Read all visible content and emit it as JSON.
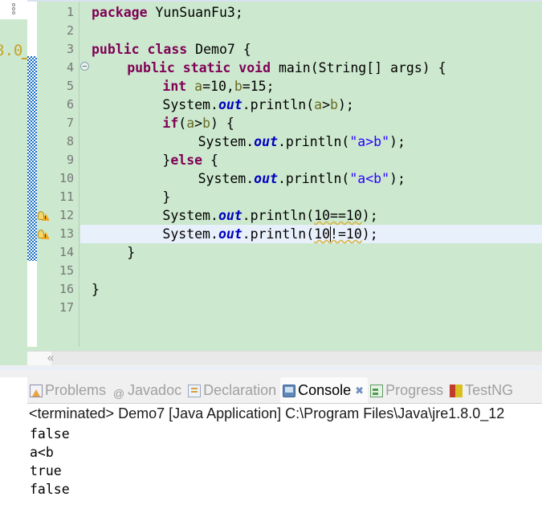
{
  "editor": {
    "background_color": "#cce8ce",
    "current_line_color": "#e8f0fb",
    "neighbor_sliver_text": "8.0",
    "drag_handle_icon": "drag-dots-icon",
    "fold_icon": "fold-collapse-icon",
    "scroll_chevron": "«",
    "line_numbers": [
      "1",
      "2",
      "3",
      "4",
      "5",
      "6",
      "7",
      "8",
      "9",
      "10",
      "11",
      "12",
      "13",
      "14",
      "15",
      "16",
      "17"
    ],
    "current_line": 13,
    "warning_lines": [
      12,
      13
    ],
    "fold_lines": [
      4
    ],
    "code_lines": [
      {
        "n": 1,
        "indent": 0,
        "tokens": [
          {
            "t": "package",
            "c": "kw"
          },
          {
            "t": " YunSuanFu3;",
            "c": ""
          }
        ]
      },
      {
        "n": 2,
        "indent": 0,
        "tokens": []
      },
      {
        "n": 3,
        "indent": 0,
        "tokens": [
          {
            "t": "public",
            "c": "kw"
          },
          {
            "t": " ",
            "c": ""
          },
          {
            "t": "class",
            "c": "kw"
          },
          {
            "t": " Demo7 {",
            "c": ""
          }
        ]
      },
      {
        "n": 4,
        "indent": 1,
        "tokens": [
          {
            "t": "public",
            "c": "kw"
          },
          {
            "t": " ",
            "c": ""
          },
          {
            "t": "static",
            "c": "kw"
          },
          {
            "t": " ",
            "c": ""
          },
          {
            "t": "void",
            "c": "kw"
          },
          {
            "t": " main(String[] args) {",
            "c": ""
          }
        ]
      },
      {
        "n": 5,
        "indent": 2,
        "tokens": [
          {
            "t": "int",
            "c": "kw"
          },
          {
            "t": " ",
            "c": ""
          },
          {
            "t": "a",
            "c": "lvar"
          },
          {
            "t": "=10,",
            "c": ""
          },
          {
            "t": "b",
            "c": "lvar"
          },
          {
            "t": "=15;",
            "c": ""
          }
        ]
      },
      {
        "n": 6,
        "indent": 2,
        "tokens": [
          {
            "t": "System.",
            "c": ""
          },
          {
            "t": "out",
            "c": "fld"
          },
          {
            "t": ".println(",
            "c": ""
          },
          {
            "t": "a",
            "c": "lvar"
          },
          {
            "t": ">",
            "c": ""
          },
          {
            "t": "b",
            "c": "lvar"
          },
          {
            "t": ");",
            "c": ""
          }
        ]
      },
      {
        "n": 7,
        "indent": 2,
        "tokens": [
          {
            "t": "if",
            "c": "kw"
          },
          {
            "t": "(",
            "c": ""
          },
          {
            "t": "a",
            "c": "lvar"
          },
          {
            "t": ">",
            "c": ""
          },
          {
            "t": "b",
            "c": "lvar"
          },
          {
            "t": ") {",
            "c": ""
          }
        ]
      },
      {
        "n": 8,
        "indent": 3,
        "tokens": [
          {
            "t": "System.",
            "c": ""
          },
          {
            "t": "out",
            "c": "fld"
          },
          {
            "t": ".println(",
            "c": ""
          },
          {
            "t": "\"a>b\"",
            "c": "str"
          },
          {
            "t": ");",
            "c": ""
          }
        ]
      },
      {
        "n": 9,
        "indent": 2,
        "tokens": [
          {
            "t": "}",
            "c": ""
          },
          {
            "t": "else",
            "c": "kw"
          },
          {
            "t": " {",
            "c": ""
          }
        ]
      },
      {
        "n": 10,
        "indent": 3,
        "tokens": [
          {
            "t": "System.",
            "c": ""
          },
          {
            "t": "out",
            "c": "fld"
          },
          {
            "t": ".println(",
            "c": ""
          },
          {
            "t": "\"a<b\"",
            "c": "str"
          },
          {
            "t": ");",
            "c": ""
          }
        ]
      },
      {
        "n": 11,
        "indent": 2,
        "tokens": [
          {
            "t": "}",
            "c": ""
          }
        ]
      },
      {
        "n": 12,
        "indent": 2,
        "tokens": [
          {
            "t": "System.",
            "c": ""
          },
          {
            "t": "out",
            "c": "fld"
          },
          {
            "t": ".println(",
            "c": ""
          },
          {
            "t": "10==10",
            "c": "warnu"
          },
          {
            "t": ");",
            "c": ""
          }
        ]
      },
      {
        "n": 13,
        "indent": 2,
        "tokens": [
          {
            "t": "System.",
            "c": ""
          },
          {
            "t": "out",
            "c": "fld"
          },
          {
            "t": ".println(",
            "c": ""
          },
          {
            "t": "10!=10",
            "c": "warnu"
          },
          {
            "t": ");",
            "c": ""
          }
        ]
      },
      {
        "n": 14,
        "indent": 1,
        "tokens": [
          {
            "t": "}",
            "c": ""
          }
        ]
      },
      {
        "n": 15,
        "indent": 0,
        "tokens": []
      },
      {
        "n": 16,
        "indent": 0,
        "tokens": [
          {
            "t": "}",
            "c": ""
          }
        ]
      },
      {
        "n": 17,
        "indent": 0,
        "tokens": []
      }
    ]
  },
  "bottom_view": {
    "tabs": [
      {
        "label": "Problems",
        "icon": "problems-icon",
        "active": false,
        "closable": false
      },
      {
        "label": "Javadoc",
        "icon": "javadoc-icon",
        "active": false,
        "closable": false
      },
      {
        "label": "Declaration",
        "icon": "declaration-icon",
        "active": false,
        "closable": false
      },
      {
        "label": "Console",
        "icon": "console-icon",
        "active": true,
        "closable": true,
        "close_glyph": "✖"
      },
      {
        "label": "Progress",
        "icon": "progress-icon",
        "active": false,
        "closable": false
      },
      {
        "label": "TestNG",
        "icon": "testng-icon",
        "active": false,
        "closable": false
      }
    ],
    "console": {
      "header": "<terminated> Demo7 [Java Application] C:\\Program Files\\Java\\jre1.8.0_12",
      "output": [
        "false",
        "a<b",
        "true",
        "false"
      ]
    }
  }
}
